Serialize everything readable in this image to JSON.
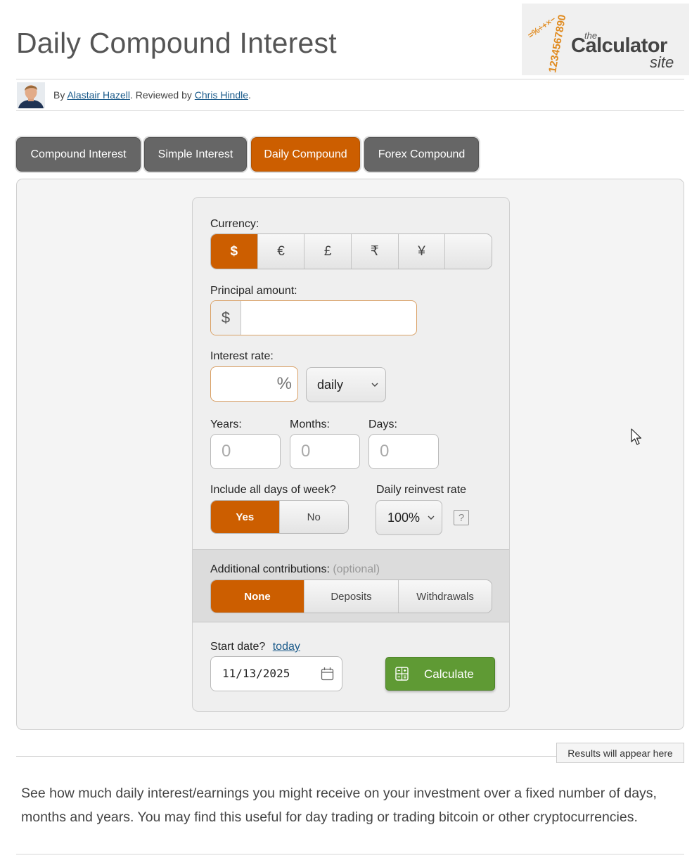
{
  "header": {
    "title": "Daily Compound Interest"
  },
  "logo": {
    "digits": "1234567890",
    "symbols": "=%÷+×−",
    "the": "the",
    "name": "Calculator",
    "site": "site"
  },
  "byline": {
    "prefix": "By ",
    "author": "Alastair Hazell",
    "middle": ". Reviewed by ",
    "reviewer": "Chris Hindle",
    "suffix": "."
  },
  "tabs": [
    {
      "label": "Compound Interest",
      "active": false
    },
    {
      "label": "Simple Interest",
      "active": false
    },
    {
      "label": "Daily Compound",
      "active": true
    },
    {
      "label": "Forex Compound",
      "active": false
    }
  ],
  "form": {
    "currency_label": "Currency:",
    "currencies": [
      "$",
      "€",
      "£",
      "₹",
      "¥",
      ""
    ],
    "currency_selected": "$",
    "principal_label": "Principal amount:",
    "principal_symbol": "$",
    "principal_value": "",
    "rate_label": "Interest rate:",
    "rate_symbol": "%",
    "rate_value": "",
    "rate_period": "daily",
    "years_label": "Years:",
    "months_label": "Months:",
    "days_label": "Days:",
    "years_placeholder": "0",
    "months_placeholder": "0",
    "days_placeholder": "0",
    "weekdays_label": "Include all days of week?",
    "weekdays_options": [
      "Yes",
      "No"
    ],
    "weekdays_selected": "Yes",
    "reinvest_label": "Daily reinvest rate",
    "reinvest_value": "100%",
    "help_glyph": "?",
    "contrib_label": "Additional contributions: ",
    "contrib_optional": "(optional)",
    "contrib_options": [
      "None",
      "Deposits",
      "Withdrawals"
    ],
    "contrib_selected": "None",
    "start_label": "Start date?",
    "start_link": "today",
    "start_value": "11/13/2025",
    "calculate_label": "Calculate"
  },
  "results_tag": "Results will appear here",
  "intro": "See how much daily interest/earnings you might receive on your investment over a fixed number of days, months and years. You may find this useful for day trading or trading bitcoin or other cryptocurrencies.",
  "colors": {
    "accent": "#cc5e00",
    "tab": "#666666",
    "calculate": "#5f9a34",
    "link": "#1a5a8a"
  },
  "icons": [
    "calendar-icon",
    "calculator-icon",
    "chevron-down-icon",
    "help-icon",
    "mouse-cursor-icon"
  ]
}
